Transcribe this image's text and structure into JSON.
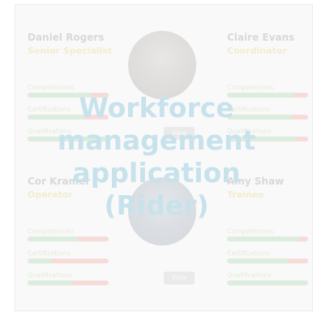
{
  "overlay": {
    "title_lines": [
      "Workforce",
      "management",
      "application",
      "(Rider)"
    ]
  },
  "metric_labels": {
    "competencies": "Competencies",
    "certifications": "Certifications",
    "qualifications": "Qualifications"
  },
  "view_button_label": "View",
  "employees": [
    {
      "name": "Daniel Rogers",
      "role": "Senior Specialist",
      "avatar_icon": "person-photo",
      "competencies": 0.78,
      "certifications": 0.7,
      "qualifications": 1.0
    },
    {
      "name": "Claire Evans",
      "role": "Coordinator",
      "avatar_icon": "none",
      "competencies": 0.82,
      "certifications": 0.8,
      "qualifications": 0.85
    },
    {
      "name": "Cor Kramer",
      "role": "Operator",
      "avatar_icon": "person-photo",
      "competencies": 0.62,
      "certifications": 0.3,
      "qualifications": 0.55
    },
    {
      "name": "Amy Shaw",
      "role": "Trainee",
      "avatar_icon": "none",
      "competencies": 0.9,
      "certifications": 0.75,
      "qualifications": 1.0
    }
  ],
  "colors": {
    "bar_good": "#4caf50",
    "bar_bad": "#e74c3c",
    "role_text": "#c9b100",
    "title_overlay": "#c8e2ec"
  }
}
